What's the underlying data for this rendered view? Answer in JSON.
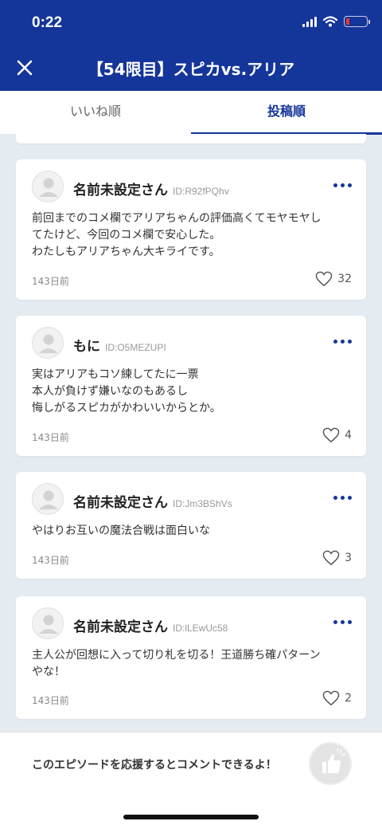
{
  "status_bar": {
    "time": "0:22",
    "battery_level": 0.18,
    "battery_color": "#e53935"
  },
  "header": {
    "title": "【54限目】スピカvs.アリア",
    "close_icon": "close-icon",
    "background": "#14359a"
  },
  "tabs": [
    {
      "label": "いいね順",
      "active": false
    },
    {
      "label": "投稿順",
      "active": true
    }
  ],
  "comments": [
    {
      "user": "名前未設定さん",
      "user_id": "ID:R92fPQhv",
      "text": "前回までのコメ欄でアリアちゃんの評価高くてモヤモヤし\nてたけど、今回のコメ欄で安心した。\nわたしもアリアちゃん大キライです。",
      "posted": "143日前",
      "likes": "32"
    },
    {
      "user": "もに",
      "user_id": "ID:O5MEZUPI",
      "text": "実はアリアもコソ練してたに一票\n本人が負けず嫌いなのもあるし\n悔しがるスピカがかわいいからとか。",
      "posted": "143日前",
      "likes": "4"
    },
    {
      "user": "名前未設定さん",
      "user_id": "ID:Jm3BShVs",
      "text": "やはりお互いの魔法合戦は面白いな",
      "posted": "143日前",
      "likes": "3"
    },
    {
      "user": "名前未設定さん",
      "user_id": "ID:lLEwUc58",
      "text": "主人公が回想に入って切り札を切る！王道勝ち確パターン\nやな！",
      "posted": "143日前",
      "likes": "2"
    }
  ],
  "bottom": {
    "cta": "このエピソードを応援するとコメントできるよ！",
    "cheer_icon": "thumbs-up-icon"
  }
}
